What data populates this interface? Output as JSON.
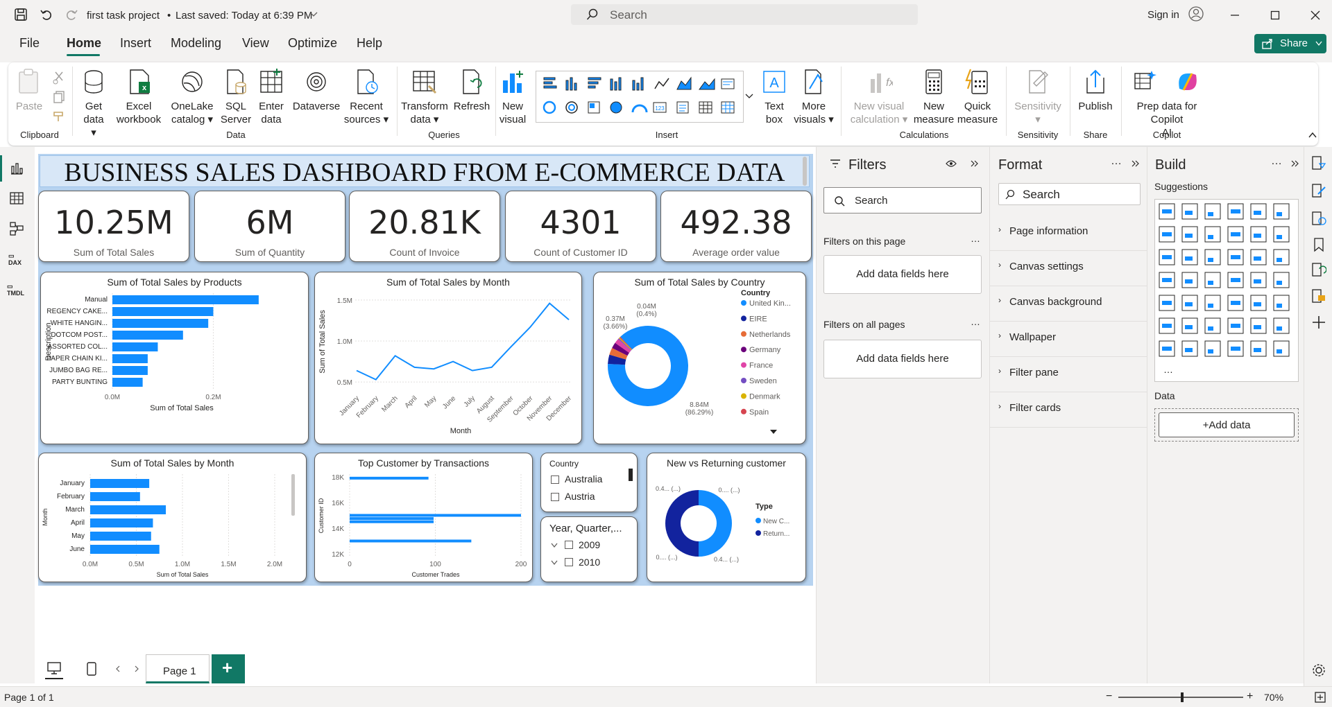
{
  "titlebar": {
    "file_name": "first task project",
    "saved": "Last saved: Today at 6:39 PM",
    "search_placeholder": "Search",
    "sign_in": "Sign in"
  },
  "menu": [
    "File",
    "Home",
    "Insert",
    "Modeling",
    "View",
    "Optimize",
    "Help"
  ],
  "share_label": "Share",
  "ribbon": {
    "paste": "Paste",
    "clipboard": "Clipboard",
    "get_data": [
      "Get",
      "data"
    ],
    "excel": [
      "Excel",
      "workbook"
    ],
    "onelake": [
      "OneLake",
      "catalog"
    ],
    "sql": [
      "SQL",
      "Server"
    ],
    "enter": [
      "Enter",
      "data"
    ],
    "dataverse": "Dataverse",
    "recent": [
      "Recent",
      "sources"
    ],
    "data_group": "Data",
    "transform": [
      "Transform",
      "data"
    ],
    "refresh": "Refresh",
    "queries_group": "Queries",
    "new_visual": [
      "New",
      "visual"
    ],
    "insert_group": "Insert",
    "text_box": [
      "Text",
      "box"
    ],
    "more_visuals": [
      "More",
      "visuals"
    ],
    "new_visual_calc": [
      "New visual",
      "calculation"
    ],
    "new_measure": [
      "New",
      "measure"
    ],
    "quick_measure": [
      "Quick",
      "measure"
    ],
    "calculations_group": "Calculations",
    "sensitivity": "Sensitivity",
    "sensitivity_group": "Sensitivity",
    "publish": "Publish",
    "share_group": "Share",
    "prep": [
      "Prep data for Copilot",
      "AI"
    ],
    "copilot_group": "Copilot"
  },
  "dashboard": {
    "title": "BUSINESS SALES DASHBOARD FROM E-COMMERCE DATA",
    "kpis": [
      {
        "value": "10.25M",
        "label": "Sum of Total Sales"
      },
      {
        "value": "6M",
        "label": "Sum of Quantity"
      },
      {
        "value": "20.81K",
        "label": "Count of Invoice"
      },
      {
        "value": "4301",
        "label": "Count of Customer ID"
      },
      {
        "value": "492.38",
        "label": "Average order value"
      }
    ]
  },
  "chart_data": [
    {
      "type": "bar",
      "title": "Sum of Total Sales by Products",
      "xlabel": "Sum of Total Sales",
      "ylabel": "Description",
      "categories": [
        "Manual",
        "REGENCY CAKE...",
        "WHITE HANGIN...",
        "DOTCOM POST...",
        "ASSORTED COL...",
        "PAPER CHAIN KI...",
        "JUMBO BAG RE...",
        "PARTY BUNTING"
      ],
      "values": [
        0.29,
        0.2,
        0.19,
        0.14,
        0.09,
        0.07,
        0.07,
        0.06
      ],
      "xticks": [
        "0.0M",
        "0.2M"
      ],
      "xlim": [
        0,
        0.3
      ]
    },
    {
      "type": "line",
      "title": "Sum of Total Sales by Month",
      "xlabel": "Month",
      "ylabel": "Sum of Total Sales",
      "categories": [
        "January",
        "February",
        "March",
        "April",
        "May",
        "June",
        "July",
        "August",
        "September",
        "October",
        "November",
        "December"
      ],
      "values": [
        0.64,
        0.53,
        0.82,
        0.68,
        0.66,
        0.75,
        0.64,
        0.68,
        0.93,
        1.17,
        1.46,
        1.26
      ],
      "yticks": [
        "0.5M",
        "1.0M",
        "1.5M"
      ],
      "ylim": [
        0.4,
        1.6
      ]
    },
    {
      "type": "pie",
      "title": "Sum of Total Sales by Country",
      "legend_title": "Country",
      "legend": [
        "United Kin...",
        "EIRE",
        "Netherlands",
        "Germany",
        "France",
        "Sweden",
        "Denmark",
        "Spain"
      ],
      "colors": [
        "#118dff",
        "#12239e",
        "#e66c37",
        "#6b007b",
        "#e044a7",
        "#744ec2",
        "#d9b300",
        "#d64550"
      ],
      "values": [
        86.29,
        3.66,
        2.8,
        2.3,
        1.9,
        0.4,
        0.4,
        0.4
      ],
      "labels": [
        "8.84M",
        "(86.29%)",
        "0.37M",
        "(3.66%)",
        "0.04M",
        "(0.4%)"
      ]
    },
    {
      "type": "bar",
      "title": "Sum of Total Sales by Month",
      "xlabel": "Sum of Total Sales",
      "ylabel": "Month",
      "categories": [
        "January",
        "February",
        "March",
        "April",
        "May",
        "June"
      ],
      "values": [
        0.64,
        0.54,
        0.82,
        0.68,
        0.66,
        0.75
      ],
      "xticks": [
        "0.0M",
        "0.5M",
        "1.0M",
        "1.5M",
        "2.0M"
      ],
      "xlim": [
        0,
        2.0
      ]
    },
    {
      "type": "bar",
      "title": "Top Customer by Transactions",
      "xlabel": "Customer Trades",
      "ylabel": "Customer ID",
      "yticks": [
        "18K",
        "16K",
        "14K",
        "12K"
      ],
      "xticks": [
        "0",
        "100",
        "200"
      ],
      "xlim": [
        0,
        200
      ],
      "ylim": [
        12000,
        18000
      ],
      "points": [
        {
          "y": 17900,
          "x": 92
        },
        {
          "y": 15000,
          "x": 200
        },
        {
          "y": 14750,
          "x": 98
        },
        {
          "y": 14500,
          "x": 98
        },
        {
          "y": 13000,
          "x": 142
        }
      ]
    },
    {
      "type": "pie",
      "title": "New vs Returning customer",
      "legend_title": "Type",
      "legend": [
        "New C...",
        "Return..."
      ],
      "colors": [
        "#118dff",
        "#12239e"
      ],
      "values": [
        50,
        50
      ],
      "labels": [
        "0.4... (...)",
        "0.... (...)",
        "0.... (...)",
        "0.4... (...)"
      ]
    }
  ],
  "slicers": {
    "country": {
      "title": "Country",
      "items": [
        "Australia",
        "Austria"
      ]
    },
    "year": {
      "title": "Year, Quarter,...",
      "items": [
        "2009",
        "2010"
      ]
    }
  },
  "filters": {
    "title": "Filters",
    "search": "Search",
    "on_page": "Filters on this page",
    "on_all": "Filters on all pages",
    "add": "Add data fields here"
  },
  "format": {
    "title": "Format",
    "search": "Search",
    "items": [
      "Page information",
      "Canvas settings",
      "Canvas background",
      "Wallpaper",
      "Filter pane",
      "Filter cards"
    ]
  },
  "build": {
    "title": "Build",
    "suggestions": "Suggestions",
    "data": "Data",
    "add_data": "+Add data"
  },
  "page_tab": "Page 1",
  "status": {
    "page": "Page 1 of 1",
    "zoom": "70%"
  }
}
